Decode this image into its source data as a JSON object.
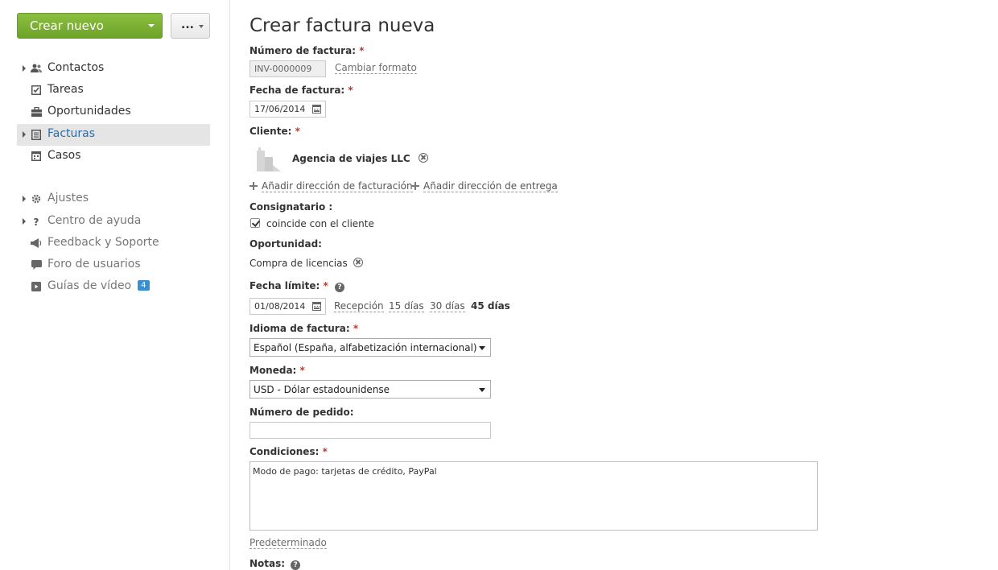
{
  "sidebar": {
    "create_label": "Crear nuevo",
    "more_label": "...",
    "items": [
      {
        "label": "Contactos",
        "icon": "contacts-icon"
      },
      {
        "label": "Tareas",
        "icon": "tasks-icon"
      },
      {
        "label": "Oportunidades",
        "icon": "briefcase-icon"
      },
      {
        "label": "Facturas",
        "icon": "invoice-icon"
      },
      {
        "label": "Casos",
        "icon": "calendar-icon"
      }
    ],
    "secondary": [
      {
        "label": "Ajustes",
        "icon": "gear-icon"
      },
      {
        "label": "Centro de ayuda",
        "icon": "question-icon"
      },
      {
        "label": "Feedback y Soporte",
        "icon": "megaphone-icon"
      },
      {
        "label": "Foro de usuarios",
        "icon": "chat-icon"
      },
      {
        "label": "Guías de vídeo",
        "icon": "video-icon",
        "badge": "4"
      }
    ]
  },
  "form": {
    "title": "Crear factura nueva",
    "required_mark": "*",
    "invoice_number": {
      "label": "Número de factura:",
      "value": "INV-0000009",
      "change_link": "Cambiar formato"
    },
    "invoice_date": {
      "label": "Fecha de factura:",
      "value": "17/06/2014"
    },
    "client": {
      "label": "Cliente:",
      "name": "Agencia de viajes LLC"
    },
    "add_billing": "Añadir dirección de facturación",
    "add_shipping": "Añadir dirección de entrega",
    "consignee": {
      "label": "Consignatario :",
      "checkbox_label": "coincide con el cliente",
      "checked": true
    },
    "opportunity": {
      "label": "Oportunidad:",
      "value": "Compra de licencias"
    },
    "due_date": {
      "label": "Fecha límite:",
      "value": "01/08/2014",
      "options": [
        "Recepción",
        "15 días",
        "30 días",
        "45 días"
      ]
    },
    "language": {
      "label": "Idioma de factura:",
      "value": "Español (España, alfabetización internacional)"
    },
    "currency": {
      "label": "Moneda:",
      "value": "USD - Dólar estadounidense"
    },
    "order_number": {
      "label": "Número de pedido:",
      "value": ""
    },
    "conditions": {
      "label": "Condiciones:",
      "value": "Modo de pago: tarjetas de crédito, PayPal",
      "default_link": "Predeterminado"
    },
    "notes": {
      "label": "Notas:"
    }
  }
}
